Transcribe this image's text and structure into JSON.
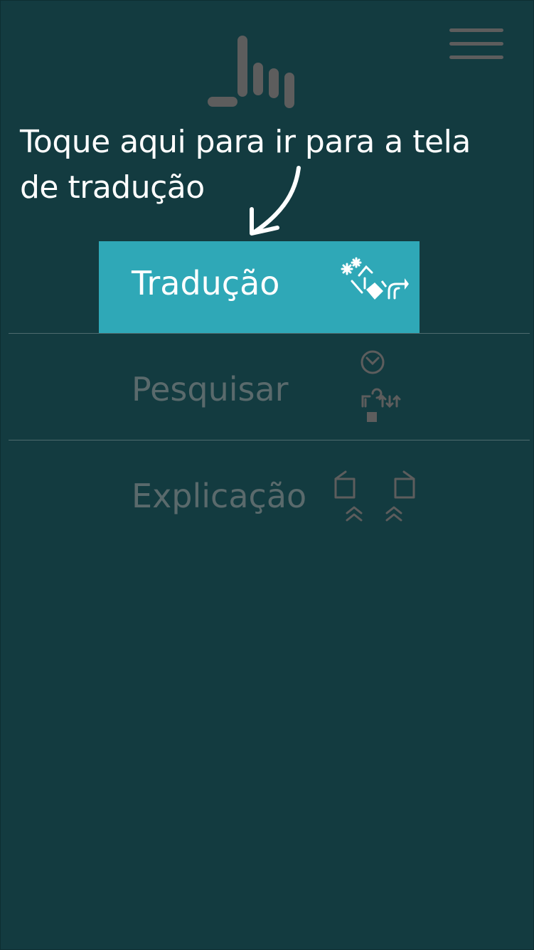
{
  "app": {
    "logo_icon": "hand-pointing-logo-icon",
    "menu_icon": "hamburger-menu-icon"
  },
  "hint": {
    "text": "Toque aqui para ir para a tela de tradução",
    "arrow_icon": "curved-arrow-down-icon"
  },
  "menu": {
    "items": [
      {
        "label": "Tradução",
        "icon": "translation-sign-icon",
        "active": true
      },
      {
        "label": "Pesquisar",
        "icon": "search-sign-icon",
        "active": false
      },
      {
        "label": "Explicação",
        "icon": "explanation-sign-icon",
        "active": false
      }
    ]
  },
  "colors": {
    "background": "#133b40",
    "active_item": "#2fa8b7",
    "inactive_text": "#5a6a6c",
    "icon_gray": "#5d5d5d",
    "white": "#ffffff"
  }
}
